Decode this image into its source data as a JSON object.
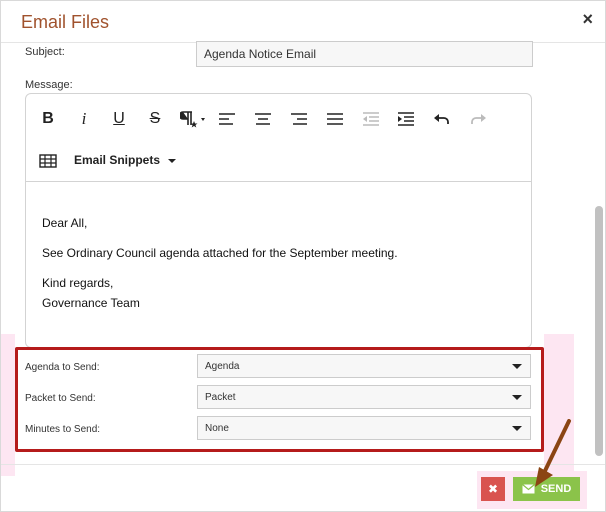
{
  "dialog": {
    "title": "Email Files",
    "close_glyph": "×"
  },
  "subject": {
    "label": "Subject:",
    "value": "Agenda Notice Email"
  },
  "message": {
    "label": "Message:"
  },
  "toolbar": {
    "bold": "B",
    "italic": "i",
    "underline": "U",
    "strikethrough": "S",
    "snippets_label": "Email Snippets"
  },
  "body": {
    "greeting": "Dear All,",
    "line1": "See Ordinary Council agenda attached for the September meeting.",
    "regards": "Kind regards,",
    "signature": "Governance Team"
  },
  "selects": {
    "agenda": {
      "label": "Agenda to Send:",
      "value": "Agenda"
    },
    "packet": {
      "label": "Packet to Send:",
      "value": "Packet"
    },
    "minutes": {
      "label": "Minutes to Send:",
      "value": "None"
    }
  },
  "buttons": {
    "cancel_glyph": "✖",
    "send_label": "SEND"
  },
  "colors": {
    "title": "#a0522d",
    "highlight": "#b51b1b",
    "send": "#8bc34a",
    "cancel": "#d9534f",
    "arrow": "#8b4513"
  }
}
